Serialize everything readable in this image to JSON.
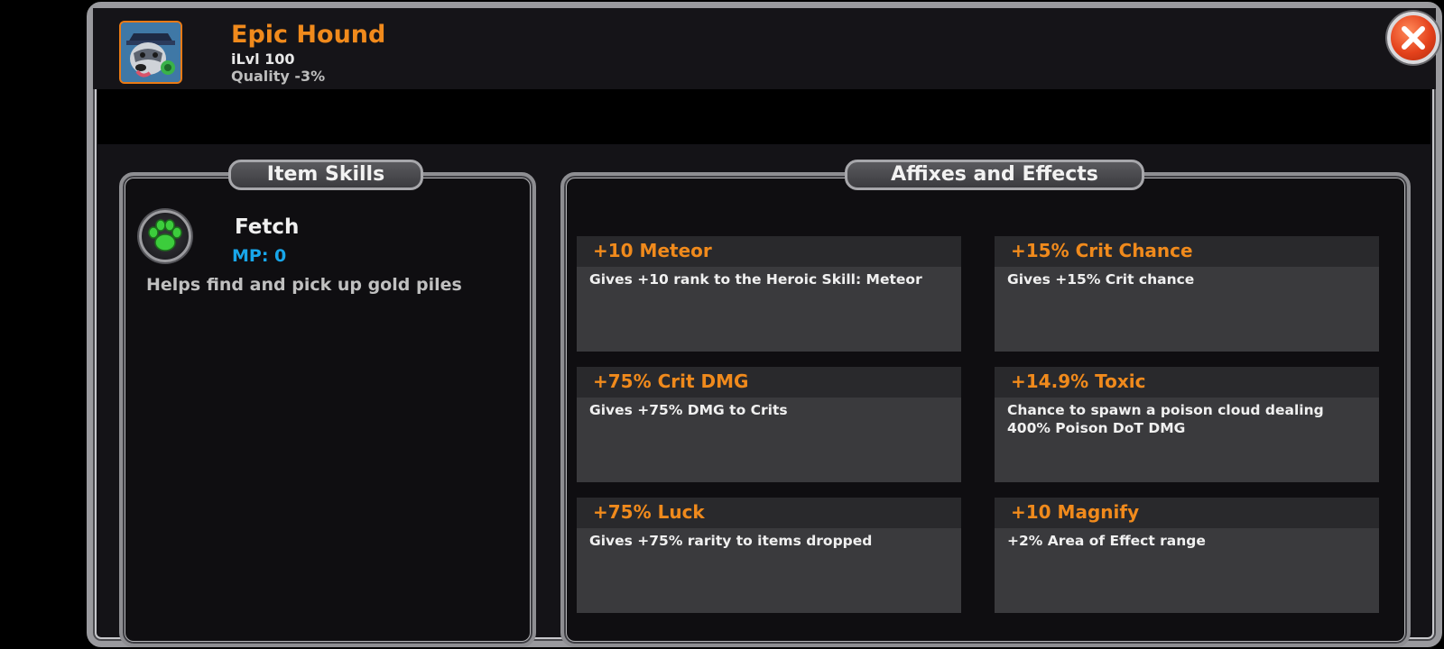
{
  "item": {
    "name": "Epic Hound",
    "ilvl": "iLvl 100",
    "quality": "Quality  -3%"
  },
  "sections": {
    "skills_title": "Item Skills",
    "affixes_title": "Affixes and Effects"
  },
  "skill": {
    "name": "Fetch",
    "mp": "MP: 0",
    "description": "Helps find and pick up gold piles",
    "icon": "paw-icon"
  },
  "affixes": [
    {
      "name": "+10 Meteor",
      "description": "Gives +10 rank to the Heroic Skill: Meteor"
    },
    {
      "name": "+15% Crit Chance",
      "description": "Gives +15% Crit chance"
    },
    {
      "name": "+75% Crit DMG",
      "description": "Gives +75% DMG to Crits"
    },
    {
      "name": "+14.9% Toxic",
      "description": "Chance to spawn a poison cloud dealing 400% Poison DoT DMG"
    },
    {
      "name": "+75% Luck",
      "description": "Gives +75% rarity to items dropped"
    },
    {
      "name": "+10 Magnify",
      "description": "+2% Area of Effect range"
    }
  ],
  "colors": {
    "title_orange": "#f08a1c",
    "mp_blue": "#18a6ea",
    "close_red": "#e4421c"
  },
  "icons": {
    "close": "close-icon",
    "avatar": "hound-avatar-icon"
  }
}
